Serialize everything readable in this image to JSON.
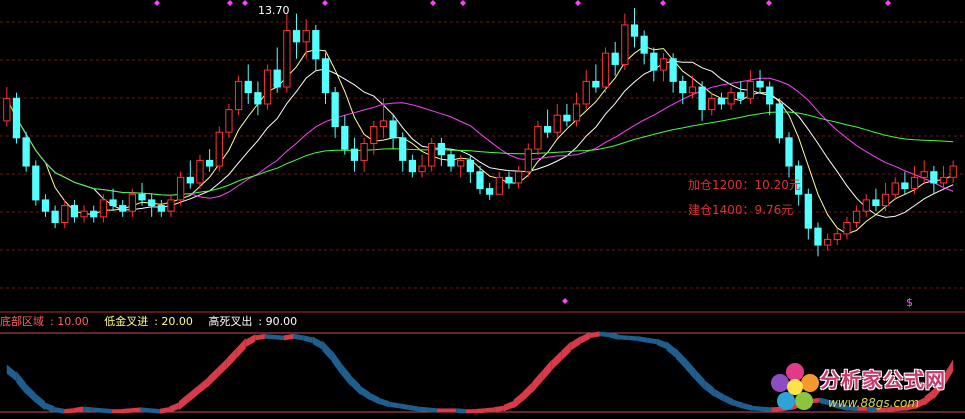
{
  "chart_data": {
    "type": "candlestick",
    "top_label": "13.70",
    "annotations": [
      {
        "text": "加仓1200：10.20元",
        "color": "#e03030"
      },
      {
        "text": "建仓1400：9.76元",
        "color": "#e03030"
      }
    ],
    "marker_symbol": "$",
    "indicator_legend": [
      {
        "label": "底部区域",
        "value": "10.00",
        "color": "#ff6060"
      },
      {
        "label": "低金叉进",
        "value": "20.00",
        "color": "#ffff80"
      },
      {
        "label": "高死叉出",
        "value": "90.00",
        "color": "#ffffff"
      }
    ],
    "price_range": [
      9.4,
      13.9
    ],
    "indicator_range": [
      0,
      100
    ],
    "ma_series": [
      {
        "color": "#ffff99",
        "period": 5
      },
      {
        "color": "#ffffff",
        "period": 10
      },
      {
        "color": "#ff40ff",
        "period": 20
      },
      {
        "color": "#40ff40",
        "period": 60
      }
    ],
    "candles": [
      [
        11.9,
        12.3,
        12.5,
        11.8
      ],
      [
        12.3,
        11.6,
        12.4,
        11.5
      ],
      [
        11.6,
        11.1,
        11.7,
        11.0
      ],
      [
        11.1,
        10.5,
        11.2,
        10.4
      ],
      [
        10.5,
        10.3,
        10.6,
        10.2
      ],
      [
        10.3,
        10.1,
        10.4,
        10.0
      ],
      [
        10.1,
        10.4,
        10.5,
        10.0
      ],
      [
        10.4,
        10.2,
        10.5,
        10.1
      ],
      [
        10.2,
        10.3,
        10.4,
        10.1
      ],
      [
        10.3,
        10.2,
        10.4,
        10.1
      ],
      [
        10.2,
        10.5,
        10.6,
        10.1
      ],
      [
        10.5,
        10.4,
        10.7,
        10.3
      ],
      [
        10.4,
        10.3,
        10.5,
        10.2
      ],
      [
        10.3,
        10.6,
        10.7,
        10.2
      ],
      [
        10.6,
        10.5,
        10.8,
        10.4
      ],
      [
        10.5,
        10.4,
        10.6,
        10.2
      ],
      [
        10.4,
        10.3,
        10.5,
        10.2
      ],
      [
        10.3,
        10.5,
        10.6,
        10.2
      ],
      [
        10.5,
        10.9,
        11.0,
        10.4
      ],
      [
        10.9,
        10.8,
        11.2,
        10.7
      ],
      [
        10.8,
        11.2,
        11.3,
        10.7
      ],
      [
        11.2,
        11.1,
        11.4,
        11.0
      ],
      [
        11.1,
        11.7,
        11.8,
        11.0
      ],
      [
        11.7,
        12.1,
        12.2,
        11.6
      ],
      [
        12.1,
        12.6,
        12.7,
        12.0
      ],
      [
        12.6,
        12.4,
        12.9,
        12.2
      ],
      [
        12.4,
        12.2,
        12.6,
        12.0
      ],
      [
        12.2,
        12.8,
        12.9,
        12.1
      ],
      [
        12.8,
        12.5,
        13.2,
        12.4
      ],
      [
        12.5,
        13.5,
        13.8,
        12.4
      ],
      [
        13.5,
        13.3,
        13.8,
        13.0
      ],
      [
        13.3,
        13.5,
        13.7,
        13.0
      ],
      [
        13.5,
        13.0,
        13.6,
        12.8
      ],
      [
        13.0,
        12.4,
        13.1,
        12.2
      ],
      [
        12.4,
        11.8,
        12.5,
        11.6
      ],
      [
        11.8,
        11.4,
        12.0,
        11.3
      ],
      [
        11.4,
        11.2,
        11.6,
        11.0
      ],
      [
        11.2,
        11.5,
        11.6,
        11.0
      ],
      [
        11.5,
        11.8,
        11.9,
        11.3
      ],
      [
        11.8,
        11.9,
        12.3,
        11.6
      ],
      [
        11.9,
        11.6,
        12.0,
        11.4
      ],
      [
        11.6,
        11.2,
        11.7,
        11.0
      ],
      [
        11.2,
        11.0,
        11.3,
        10.9
      ],
      [
        11.0,
        11.1,
        11.3,
        10.9
      ],
      [
        11.1,
        11.5,
        11.6,
        11.0
      ],
      [
        11.5,
        11.3,
        11.6,
        11.1
      ],
      [
        11.3,
        11.1,
        11.4,
        11.0
      ],
      [
        11.1,
        11.2,
        11.3,
        10.9
      ],
      [
        11.2,
        11.0,
        11.3,
        10.8
      ],
      [
        11.0,
        10.7,
        11.1,
        10.6
      ],
      [
        10.7,
        10.6,
        10.8,
        10.5
      ],
      [
        10.6,
        10.9,
        11.0,
        10.6
      ],
      [
        10.9,
        10.8,
        11.0,
        10.7
      ],
      [
        10.8,
        11.0,
        11.1,
        10.7
      ],
      [
        11.0,
        11.4,
        11.5,
        10.9
      ],
      [
        11.4,
        11.8,
        11.9,
        11.3
      ],
      [
        11.8,
        11.7,
        12.1,
        11.6
      ],
      [
        11.7,
        12.0,
        12.2,
        11.6
      ],
      [
        12.0,
        11.9,
        12.2,
        11.8
      ],
      [
        11.9,
        12.2,
        12.4,
        11.8
      ],
      [
        12.2,
        12.6,
        12.8,
        12.1
      ],
      [
        12.6,
        12.5,
        12.9,
        12.4
      ],
      [
        12.5,
        13.1,
        13.2,
        12.4
      ],
      [
        13.1,
        12.9,
        13.3,
        12.7
      ],
      [
        12.9,
        13.6,
        13.8,
        12.8
      ],
      [
        13.6,
        13.4,
        13.9,
        13.2
      ],
      [
        13.4,
        13.1,
        13.5,
        12.9
      ],
      [
        13.1,
        12.8,
        13.2,
        12.6
      ],
      [
        12.8,
        13.0,
        13.1,
        12.6
      ],
      [
        13.0,
        12.6,
        13.1,
        12.4
      ],
      [
        12.6,
        12.4,
        12.7,
        12.2
      ],
      [
        12.4,
        12.5,
        12.7,
        12.3
      ],
      [
        12.5,
        12.1,
        12.6,
        11.9
      ],
      [
        12.1,
        12.3,
        12.4,
        12.0
      ],
      [
        12.3,
        12.2,
        12.4,
        12.1
      ],
      [
        12.2,
        12.4,
        12.5,
        12.1
      ],
      [
        12.4,
        12.3,
        12.6,
        12.2
      ],
      [
        12.3,
        12.6,
        12.8,
        12.2
      ],
      [
        12.6,
        12.5,
        12.8,
        12.4
      ],
      [
        12.5,
        12.2,
        12.6,
        12.0
      ],
      [
        12.2,
        11.6,
        12.3,
        11.5
      ],
      [
        11.6,
        11.1,
        11.7,
        10.9
      ],
      [
        11.1,
        10.6,
        11.2,
        10.4
      ],
      [
        10.6,
        10.0,
        10.7,
        9.8
      ],
      [
        10.0,
        9.7,
        10.1,
        9.5
      ],
      [
        9.7,
        9.8,
        9.9,
        9.6
      ],
      [
        9.8,
        9.9,
        10.0,
        9.7
      ],
      [
        9.9,
        10.1,
        10.2,
        9.8
      ],
      [
        10.1,
        10.3,
        10.4,
        10.0
      ],
      [
        10.3,
        10.5,
        10.6,
        10.2
      ],
      [
        10.5,
        10.4,
        10.7,
        10.3
      ],
      [
        10.4,
        10.6,
        10.8,
        10.3
      ],
      [
        10.6,
        10.8,
        10.9,
        10.5
      ],
      [
        10.8,
        10.7,
        11.0,
        10.6
      ],
      [
        10.7,
        10.9,
        11.1,
        10.6
      ],
      [
        10.9,
        11.0,
        11.2,
        10.8
      ],
      [
        11.0,
        10.8,
        11.1,
        10.6
      ],
      [
        10.8,
        10.9,
        11.1,
        10.7
      ],
      [
        10.9,
        11.1,
        11.2,
        10.8
      ]
    ],
    "indicator": [
      55,
      45,
      30,
      18,
      8,
      3,
      1,
      2,
      4,
      3,
      2,
      1,
      1,
      2,
      3,
      2,
      1,
      3,
      8,
      18,
      28,
      38,
      50,
      62,
      75,
      88,
      95,
      97,
      96,
      95,
      97,
      95,
      92,
      85,
      72,
      55,
      40,
      28,
      20,
      14,
      10,
      8,
      6,
      4,
      3,
      2,
      2,
      2,
      1,
      1,
      2,
      3,
      5,
      10,
      20,
      32,
      46,
      60,
      72,
      84,
      92,
      98,
      100,
      99,
      96,
      95,
      94,
      92,
      90,
      85,
      75,
      62,
      48,
      35,
      25,
      18,
      12,
      8,
      5,
      4,
      3,
      4,
      6,
      10,
      14,
      15,
      12,
      8,
      5,
      4,
      4,
      3,
      3,
      4,
      5,
      8,
      14,
      24,
      40,
      60
    ]
  }
}
